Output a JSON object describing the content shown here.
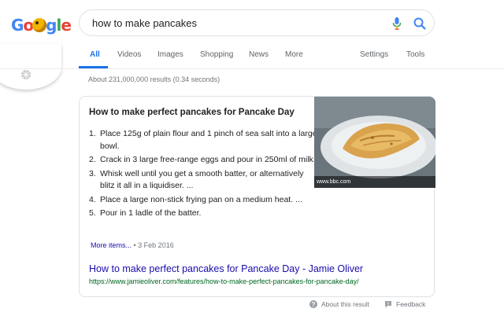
{
  "logo": {
    "text": "Google"
  },
  "search": {
    "query": "how to make pancakes"
  },
  "tabs": {
    "all": "All",
    "videos": "Videos",
    "images": "Images",
    "shopping": "Shopping",
    "news": "News",
    "more": "More",
    "settings": "Settings",
    "tools": "Tools"
  },
  "stats": "About 231,000,000 results (0.34 seconds)",
  "snippet": {
    "title": "How to make perfect pancakes for Pancake Day",
    "steps": [
      {
        "num": "1.",
        "text": "Place 125g of plain flour and 1 pinch of sea salt into a large bowl."
      },
      {
        "num": "2.",
        "text": "Crack in 3 large free-range eggs and pour in 250ml of milk."
      },
      {
        "num": "3.",
        "text": "Whisk well until you get a smooth batter, or alternatively blitz it all in a liquidiser. ..."
      },
      {
        "num": "4.",
        "text": "Place a large non-stick frying pan on a medium heat. ..."
      },
      {
        "num": "5.",
        "text": "Pour in 1 ladle of the batter."
      }
    ],
    "more_items": "More items...",
    "date": " • 3 Feb 2016",
    "image_caption": "www.bbc.com"
  },
  "result": {
    "title": "How to make perfect pancakes for Pancake Day - Jamie Oliver",
    "url": "https://www.jamieoliver.com/features/how-to-make-perfect-pancakes-for-pancake-day/"
  },
  "footer": {
    "about": "About this result",
    "feedback": "Feedback"
  },
  "colors": {
    "accent": "#1a73e8",
    "link": "#1a0dab",
    "url_green": "#006621"
  }
}
